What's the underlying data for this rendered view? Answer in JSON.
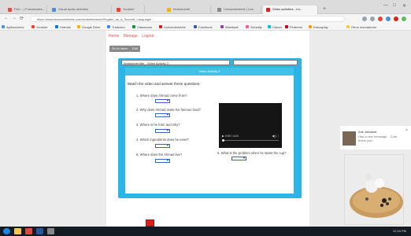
{
  "browser": {
    "tabs": [
      {
        "title": "Fish... | Funcionales..."
      },
      {
        "title": "Visual audio activities"
      },
      {
        "title": "Youtube"
      },
      {
        "title": "Worksheets"
      },
      {
        "title": "Liveworksheets | Live"
      },
      {
        "title": "Video activities - Liv..."
      }
    ],
    "newtab": "+",
    "window_controls": [
      "—",
      "□",
      "✕"
    ],
    "address": "https://www.liveworksheets.com/worksheets/en/English_as_a_Second_Language/..."
  },
  "bookmarks": [
    {
      "label": "Aplicaciones"
    },
    {
      "label": "Youtube"
    },
    {
      "label": "Hotmail"
    },
    {
      "label": "Google Drive"
    },
    {
      "label": "Traductor"
    },
    {
      "label": "Classroom"
    },
    {
      "label": "Liveworksheets"
    },
    {
      "label": "Facebook"
    },
    {
      "label": "Wordwall"
    },
    {
      "label": "Genially"
    },
    {
      "label": "Canva"
    },
    {
      "label": "Pinterest"
    },
    {
      "label": "Educaplay"
    },
    {
      "label": "Otros marcadores"
    }
  ],
  "page": {
    "links": [
      "Home",
      "Manage",
      "Logout"
    ],
    "buttons": {
      "back": "Go to index",
      "edit": "Edit"
    },
    "selects": {
      "left": "Worksheet title  -  Video Activity 2",
      "right": ""
    },
    "activity_title": "Video Activity 2",
    "instruction": "Watch the video and answer these questions:",
    "questions": [
      "1. Where does Ahmad come from?",
      "2. Why does Ahmad make his famous food?",
      "3. Where is he from and why?",
      "4. Which ingredients does he need?",
      "5. Where does the Ahmad live?",
      "6. What is the problem when he starts the cup?"
    ],
    "video_time": "0:00 / 4:24",
    "finish": "Finish"
  },
  "chat": {
    "name": "Zoe Johnson",
    "message": "Has a new message... Cute, thank you!",
    "close": "×"
  },
  "taskbar": {
    "clock": "12:34 PM"
  },
  "colors": {
    "accent": "#29b6e6",
    "red": "#d9201f",
    "link": "#d9534f"
  }
}
